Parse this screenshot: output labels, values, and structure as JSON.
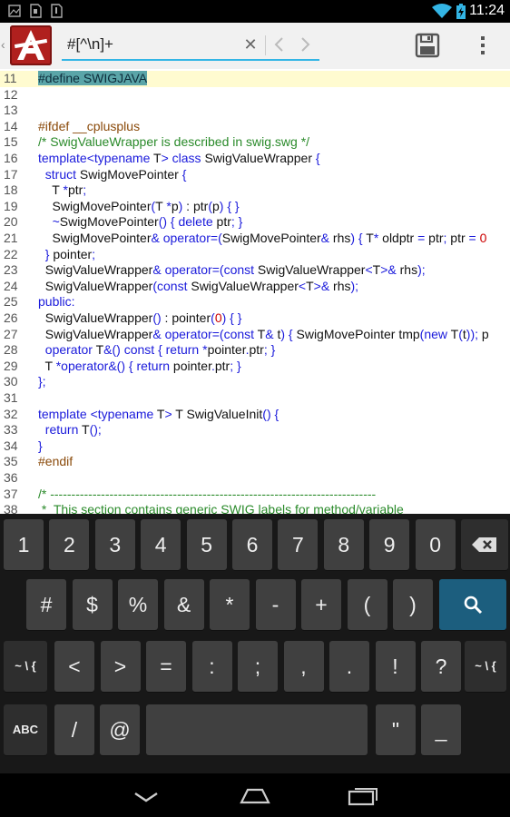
{
  "status_bar": {
    "time": "11:24",
    "icons": [
      "image-notification-icon",
      "sd-card-notification-icon",
      "download-notification-icon",
      "wifi-icon",
      "battery-icon"
    ]
  },
  "action_bar": {
    "search_value": "#[^\\n]+",
    "icons": [
      "app-logo-icon",
      "clear-icon",
      "previous-arrow-icon",
      "next-arrow-icon",
      "save-icon",
      "overflow-menu-icon"
    ]
  },
  "editor": {
    "colors": {
      "keyword": "#1a1adb",
      "comment": "#2a8a2a",
      "preproc": "#8a4a0a",
      "number": "#cc0000",
      "highlight": "#5aa5a8",
      "current_line": "#fffbd0"
    },
    "lines": [
      {
        "n": "11",
        "segs": [
          {
            "t": "#define SWIGJAVA",
            "c": "hl"
          }
        ]
      },
      {
        "n": "12",
        "segs": []
      },
      {
        "n": "13",
        "segs": []
      },
      {
        "n": "14",
        "segs": [
          {
            "t": "#ifdef __cplusplus",
            "c": "pp"
          }
        ]
      },
      {
        "n": "15",
        "segs": [
          {
            "t": "/* SwigValueWrapper is described in swig.swg */",
            "c": "cm"
          }
        ]
      },
      {
        "n": "16",
        "segs": [
          {
            "t": "template",
            "c": "kw"
          },
          {
            "t": "<",
            "c": "op"
          },
          {
            "t": "typename",
            "c": "kw"
          },
          {
            "t": " T",
            "c": ""
          },
          {
            "t": ">",
            "c": "op"
          },
          {
            "t": " ",
            "c": ""
          },
          {
            "t": "class",
            "c": "kw"
          },
          {
            "t": " SwigValueWrapper ",
            "c": ""
          },
          {
            "t": "{",
            "c": "op"
          }
        ]
      },
      {
        "n": "17",
        "segs": [
          {
            "t": "  ",
            "c": ""
          },
          {
            "t": "struct",
            "c": "kw"
          },
          {
            "t": " SwigMovePointer ",
            "c": ""
          },
          {
            "t": "{",
            "c": "op"
          }
        ]
      },
      {
        "n": "18",
        "segs": [
          {
            "t": "    T ",
            "c": ""
          },
          {
            "t": "*",
            "c": "op"
          },
          {
            "t": "ptr",
            "c": ""
          },
          {
            "t": ";",
            "c": "op"
          }
        ]
      },
      {
        "n": "19",
        "segs": [
          {
            "t": "    SwigMovePointer",
            "c": ""
          },
          {
            "t": "(",
            "c": "op"
          },
          {
            "t": "T ",
            "c": ""
          },
          {
            "t": "*",
            "c": "op"
          },
          {
            "t": "p",
            "c": ""
          },
          {
            "t": ")",
            "c": "op"
          },
          {
            "t": " : ptr",
            "c": ""
          },
          {
            "t": "(",
            "c": "op"
          },
          {
            "t": "p",
            "c": ""
          },
          {
            "t": ")",
            "c": "op"
          },
          {
            "t": " ",
            "c": ""
          },
          {
            "t": "{ }",
            "c": "op"
          }
        ]
      },
      {
        "n": "20",
        "segs": [
          {
            "t": "    ",
            "c": ""
          },
          {
            "t": "~",
            "c": "op"
          },
          {
            "t": "SwigMovePointer",
            "c": ""
          },
          {
            "t": "()",
            "c": "op"
          },
          {
            "t": " ",
            "c": ""
          },
          {
            "t": "{",
            "c": "op"
          },
          {
            "t": " ",
            "c": ""
          },
          {
            "t": "delete",
            "c": "kw"
          },
          {
            "t": " ptr",
            "c": ""
          },
          {
            "t": "; }",
            "c": "op"
          }
        ]
      },
      {
        "n": "21",
        "segs": [
          {
            "t": "    SwigMovePointer",
            "c": ""
          },
          {
            "t": "&",
            "c": "op"
          },
          {
            "t": " ",
            "c": ""
          },
          {
            "t": "operator",
            "c": "kw"
          },
          {
            "t": "=(",
            "c": "op"
          },
          {
            "t": "SwigMovePointer",
            "c": ""
          },
          {
            "t": "&",
            "c": "op"
          },
          {
            "t": " rhs",
            "c": ""
          },
          {
            "t": ")",
            "c": "op"
          },
          {
            "t": " ",
            "c": ""
          },
          {
            "t": "{",
            "c": "op"
          },
          {
            "t": " T",
            "c": ""
          },
          {
            "t": "*",
            "c": "op"
          },
          {
            "t": " oldptr ",
            "c": ""
          },
          {
            "t": "=",
            "c": "op"
          },
          {
            "t": " ptr",
            "c": ""
          },
          {
            "t": ";",
            "c": "op"
          },
          {
            "t": " ptr ",
            "c": ""
          },
          {
            "t": "=",
            "c": "op"
          },
          {
            "t": " ",
            "c": ""
          },
          {
            "t": "0",
            "c": "num"
          }
        ]
      },
      {
        "n": "22",
        "segs": [
          {
            "t": "  ",
            "c": ""
          },
          {
            "t": "}",
            "c": "op"
          },
          {
            "t": " pointer",
            "c": ""
          },
          {
            "t": ";",
            "c": "op"
          }
        ]
      },
      {
        "n": "23",
        "segs": [
          {
            "t": "  SwigValueWrapper",
            "c": ""
          },
          {
            "t": "&",
            "c": "op"
          },
          {
            "t": " ",
            "c": ""
          },
          {
            "t": "operator",
            "c": "kw"
          },
          {
            "t": "=(",
            "c": "op"
          },
          {
            "t": "const",
            "c": "kw"
          },
          {
            "t": " SwigValueWrapper",
            "c": ""
          },
          {
            "t": "<",
            "c": "op"
          },
          {
            "t": "T",
            "c": ""
          },
          {
            "t": ">&",
            "c": "op"
          },
          {
            "t": " rhs",
            "c": ""
          },
          {
            "t": ");",
            "c": "op"
          }
        ]
      },
      {
        "n": "24",
        "segs": [
          {
            "t": "  SwigValueWrapper",
            "c": ""
          },
          {
            "t": "(",
            "c": "op"
          },
          {
            "t": "const",
            "c": "kw"
          },
          {
            "t": " SwigValueWrapper",
            "c": ""
          },
          {
            "t": "<",
            "c": "op"
          },
          {
            "t": "T",
            "c": ""
          },
          {
            "t": ">&",
            "c": "op"
          },
          {
            "t": " rhs",
            "c": ""
          },
          {
            "t": ");",
            "c": "op"
          }
        ]
      },
      {
        "n": "25",
        "segs": [
          {
            "t": "public",
            "c": "kw"
          },
          {
            "t": ":",
            "c": "op"
          }
        ]
      },
      {
        "n": "26",
        "segs": [
          {
            "t": "  SwigValueWrapper",
            "c": ""
          },
          {
            "t": "()",
            "c": "op"
          },
          {
            "t": " : pointer",
            "c": ""
          },
          {
            "t": "(",
            "c": "op"
          },
          {
            "t": "0",
            "c": "num"
          },
          {
            "t": ")",
            "c": "op"
          },
          {
            "t": " ",
            "c": ""
          },
          {
            "t": "{ }",
            "c": "op"
          }
        ]
      },
      {
        "n": "27",
        "segs": [
          {
            "t": "  SwigValueWrapper",
            "c": ""
          },
          {
            "t": "&",
            "c": "op"
          },
          {
            "t": " ",
            "c": ""
          },
          {
            "t": "operator",
            "c": "kw"
          },
          {
            "t": "=(",
            "c": "op"
          },
          {
            "t": "const",
            "c": "kw"
          },
          {
            "t": " T",
            "c": ""
          },
          {
            "t": "&",
            "c": "op"
          },
          {
            "t": " t",
            "c": ""
          },
          {
            "t": ")",
            "c": "op"
          },
          {
            "t": " ",
            "c": ""
          },
          {
            "t": "{",
            "c": "op"
          },
          {
            "t": " SwigMovePointer tmp",
            "c": ""
          },
          {
            "t": "(",
            "c": "op"
          },
          {
            "t": "new",
            "c": "kw"
          },
          {
            "t": " T",
            "c": ""
          },
          {
            "t": "(",
            "c": "op"
          },
          {
            "t": "t",
            "c": ""
          },
          {
            "t": "));",
            "c": "op"
          },
          {
            "t": " p",
            "c": ""
          }
        ]
      },
      {
        "n": "28",
        "segs": [
          {
            "t": "  ",
            "c": ""
          },
          {
            "t": "operator",
            "c": "kw"
          },
          {
            "t": " T",
            "c": ""
          },
          {
            "t": "&()",
            "c": "op"
          },
          {
            "t": " ",
            "c": ""
          },
          {
            "t": "const",
            "c": "kw"
          },
          {
            "t": " ",
            "c": ""
          },
          {
            "t": "{",
            "c": "op"
          },
          {
            "t": " ",
            "c": ""
          },
          {
            "t": "return",
            "c": "kw"
          },
          {
            "t": " ",
            "c": ""
          },
          {
            "t": "*",
            "c": "op"
          },
          {
            "t": "pointer",
            "c": ""
          },
          {
            "t": ".",
            "c": "op"
          },
          {
            "t": "ptr",
            "c": ""
          },
          {
            "t": "; }",
            "c": "op"
          }
        ]
      },
      {
        "n": "29",
        "segs": [
          {
            "t": "  T ",
            "c": ""
          },
          {
            "t": "*",
            "c": "op"
          },
          {
            "t": "operator",
            "c": "kw"
          },
          {
            "t": "&()",
            "c": "op"
          },
          {
            "t": " ",
            "c": ""
          },
          {
            "t": "{",
            "c": "op"
          },
          {
            "t": " ",
            "c": ""
          },
          {
            "t": "return",
            "c": "kw"
          },
          {
            "t": " pointer",
            "c": ""
          },
          {
            "t": ".",
            "c": "op"
          },
          {
            "t": "ptr",
            "c": ""
          },
          {
            "t": "; }",
            "c": "op"
          }
        ]
      },
      {
        "n": "30",
        "segs": [
          {
            "t": "};",
            "c": "op"
          }
        ]
      },
      {
        "n": "31",
        "segs": []
      },
      {
        "n": "32",
        "segs": [
          {
            "t": "template",
            "c": "kw"
          },
          {
            "t": " ",
            "c": ""
          },
          {
            "t": "<",
            "c": "op"
          },
          {
            "t": "typename",
            "c": "kw"
          },
          {
            "t": " T",
            "c": ""
          },
          {
            "t": ">",
            "c": "op"
          },
          {
            "t": " T SwigValueInit",
            "c": ""
          },
          {
            "t": "()",
            "c": "op"
          },
          {
            "t": " ",
            "c": ""
          },
          {
            "t": "{",
            "c": "op"
          }
        ]
      },
      {
        "n": "33",
        "segs": [
          {
            "t": "  ",
            "c": ""
          },
          {
            "t": "return",
            "c": "kw"
          },
          {
            "t": " T",
            "c": ""
          },
          {
            "t": "();",
            "c": "op"
          }
        ]
      },
      {
        "n": "34",
        "segs": [
          {
            "t": "}",
            "c": "op"
          }
        ]
      },
      {
        "n": "35",
        "segs": [
          {
            "t": "#endif",
            "c": "pp"
          }
        ]
      },
      {
        "n": "36",
        "segs": []
      },
      {
        "n": "37",
        "segs": [
          {
            "t": "/* -----------------------------------------------------------------------------",
            "c": "cm"
          }
        ]
      },
      {
        "n": "38",
        "segs": [
          {
            "t": " *  This section contains generic SWIG labels for method/variable",
            "c": "cm"
          }
        ]
      }
    ]
  },
  "keyboard": {
    "row1": [
      "1",
      "2",
      "3",
      "4",
      "5",
      "6",
      "7",
      "8",
      "9",
      "0"
    ],
    "row2": [
      "#",
      "$",
      "%",
      "&",
      "*",
      "-",
      "+",
      "(",
      ")"
    ],
    "row3": [
      "<",
      ">",
      "=",
      ":",
      ";",
      ",",
      ".",
      "!",
      "?"
    ],
    "symbol_shift": "~ \\ {",
    "abc": "ABC",
    "slash": "/",
    "at": "@",
    "quote": "\"",
    "underscore": "_",
    "icons": [
      "backspace-icon",
      "search-key-icon"
    ]
  },
  "nav_bar": {
    "icons": [
      "back-nav-icon",
      "home-nav-icon",
      "recent-apps-icon"
    ]
  }
}
